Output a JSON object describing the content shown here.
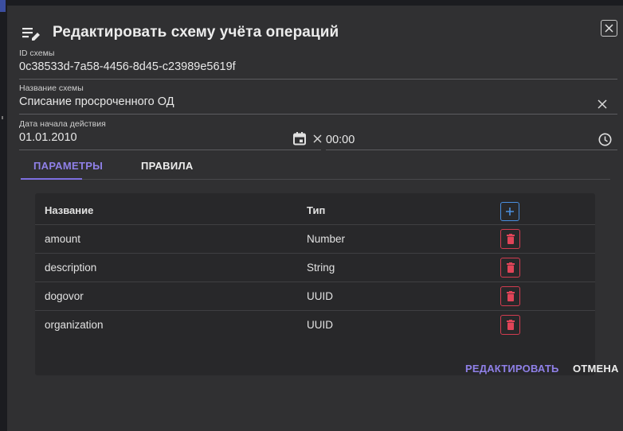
{
  "dialog": {
    "title": "Редактировать схему учёта операций",
    "title_icon": "edit-list-icon",
    "close_icon": "close-icon"
  },
  "fields": {
    "scheme_id": {
      "label": "ID схемы",
      "value": "0c38533d-7a58-4456-8d45-c23989e5619f"
    },
    "scheme_name": {
      "label": "Название схемы",
      "value": "Списание просроченного ОД",
      "clear_icon": "clear-icon"
    },
    "start_date": {
      "label": "Дата начала действия",
      "value": "01.01.2010",
      "calendar_icon": "calendar-icon",
      "clear_icon": "clear-icon"
    },
    "start_time": {
      "value": "00:00",
      "clock_icon": "clock-icon"
    }
  },
  "tabs": [
    {
      "label": "ПАРАМЕТРЫ",
      "active": true
    },
    {
      "label": "ПРАВИЛА",
      "active": false
    }
  ],
  "table": {
    "headers": {
      "name": "Название",
      "type": "Тип"
    },
    "add_icon": "plus-icon",
    "delete_icon": "trash-icon",
    "rows": [
      {
        "name": "amount",
        "type": "Number"
      },
      {
        "name": "description",
        "type": "String"
      },
      {
        "name": "dogovor",
        "type": "UUID"
      },
      {
        "name": "organization",
        "type": "UUID"
      }
    ]
  },
  "footer": {
    "edit_label": "РЕДАКТИРОВАТЬ",
    "cancel_label": "ОТМЕНА"
  },
  "colors": {
    "accent": "#8f80e8",
    "add_button": "#4a8fe0",
    "delete_button": "#d23c50",
    "dialog_bg": "#303032",
    "panel_bg": "#28282a"
  }
}
